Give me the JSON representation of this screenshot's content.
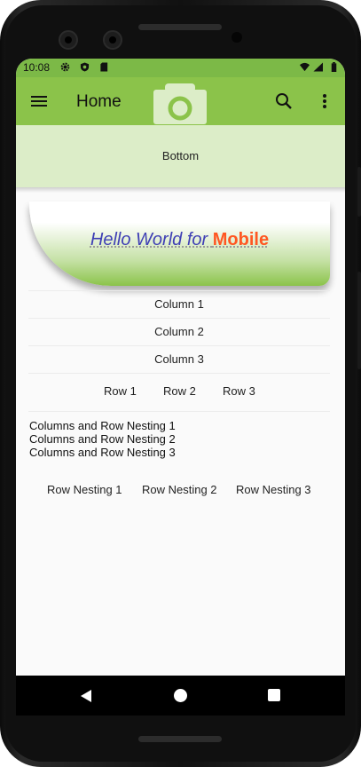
{
  "status_bar": {
    "time": "10:08"
  },
  "app_bar": {
    "title": "Home"
  },
  "bottom_area": {
    "label": "Bottom"
  },
  "hello_card": {
    "text_part1": "Hello World for ",
    "text_highlight": "Mobile"
  },
  "columns": [
    {
      "label": "Column 1"
    },
    {
      "label": "Column 2"
    },
    {
      "label": "Column 3"
    }
  ],
  "rows": [
    {
      "label": "Row 1"
    },
    {
      "label": "Row 2"
    },
    {
      "label": "Row 3"
    }
  ],
  "nesting_columns": [
    {
      "label": "Columns and Row Nesting 1"
    },
    {
      "label": "Columns and Row Nesting 2"
    },
    {
      "label": "Columns and Row Nesting 3"
    }
  ],
  "row_nesting": [
    {
      "label": "Row Nesting 1"
    },
    {
      "label": "Row Nesting 2"
    },
    {
      "label": "Row Nesting 3"
    }
  ],
  "icons": {
    "menu": "menu-icon",
    "search": "search-icon",
    "more": "more-vert-icon",
    "camera": "camera-icon",
    "status": [
      "gear-icon",
      "shield-icon",
      "sim-card-icon",
      "wifi-icon",
      "signal-icon",
      "battery-icon"
    ],
    "nav": [
      "back-icon",
      "home-icon",
      "recents-icon"
    ]
  },
  "colors": {
    "accent": "#8bc34a",
    "status_bar": "#7cb947",
    "bottom_area": "#dcedc8",
    "hello_text": "#3f3fb5",
    "highlight": "#ff5722"
  }
}
